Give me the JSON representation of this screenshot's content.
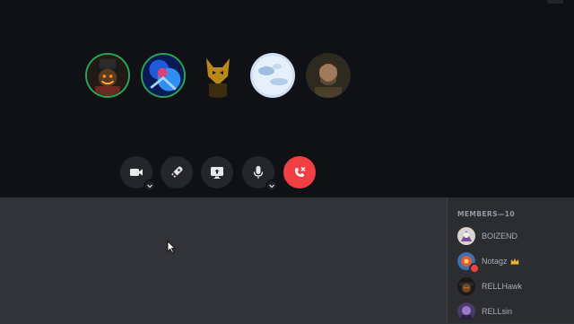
{
  "stage": {
    "participants": [
      {
        "avatar_icon": "villain-avatar",
        "speaking": true
      },
      {
        "avatar_icon": "blue-warrior-avatar",
        "speaking": true
      },
      {
        "avatar_icon": "gold-cat-avatar",
        "speaking": false
      },
      {
        "avatar_icon": "snowy-planet-avatar",
        "speaking": false
      },
      {
        "avatar_icon": "bearded-man-avatar",
        "speaking": false
      }
    ]
  },
  "controls": [
    {
      "icon": "video-camera-icon",
      "has_dropdown": true
    },
    {
      "icon": "rocket-icon",
      "has_dropdown": false
    },
    {
      "icon": "screen-share-icon",
      "has_dropdown": false
    },
    {
      "icon": "microphone-icon",
      "has_dropdown": true
    },
    {
      "icon": "end-call-icon",
      "has_dropdown": false
    }
  ],
  "members": {
    "header": "MEMBERS—10",
    "list": [
      {
        "name": "BOIZEND",
        "avatar_icon": "boizend-avatar",
        "owner": false,
        "status": ""
      },
      {
        "name": "Notagz",
        "avatar_icon": "notagz-avatar",
        "owner": true,
        "status": "dnd"
      },
      {
        "name": "RELLHawk",
        "avatar_icon": "rellhawk-avatar",
        "owner": false,
        "status": ""
      },
      {
        "name": "RELLsin",
        "avatar_icon": "rellsin-avatar",
        "owner": false,
        "status": ""
      }
    ]
  },
  "colors": {
    "stage_bg": "#0f1114",
    "panel_bg": "#313338",
    "members_bg": "#2b2d31",
    "speaking_ring": "#23a55a",
    "end_call": "#f23f43",
    "crown": "#f0b232"
  }
}
